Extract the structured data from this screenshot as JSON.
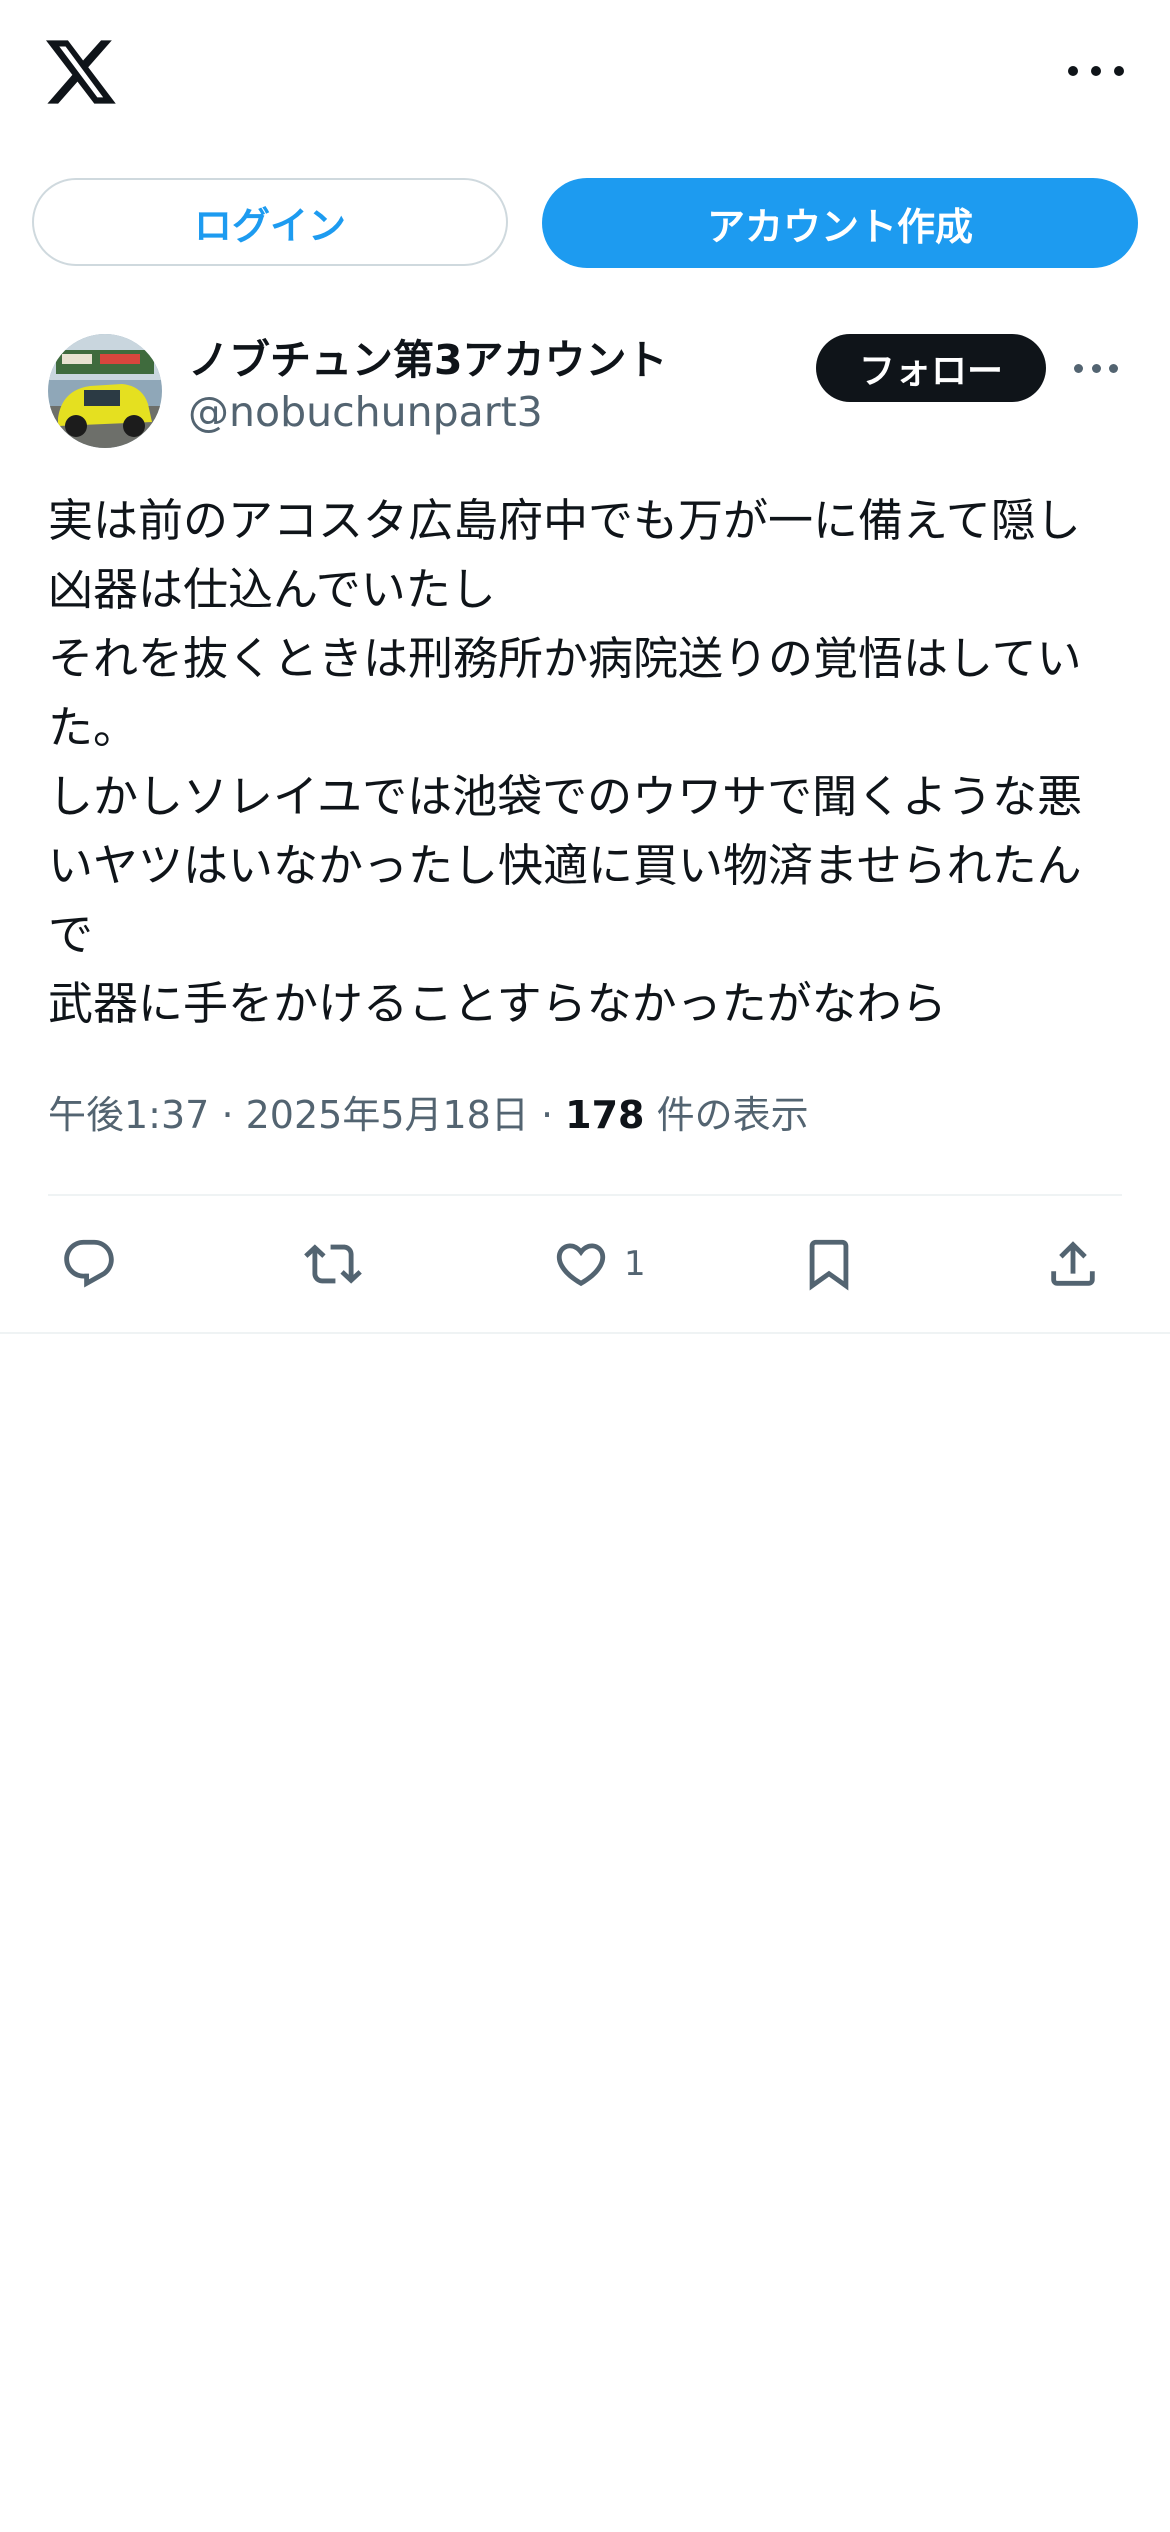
{
  "header": {
    "logo_icon": "x-logo-icon",
    "more_icon": "more-horizontal-icon"
  },
  "auth": {
    "login_label": "ログイン",
    "signup_label": "アカウント作成"
  },
  "tweet": {
    "display_name": "ノブチュン第3アカウント",
    "handle": "@nobuchunpart3",
    "follow_label": "フォロー",
    "body": "実は前のアコスタ広島府中でも万が一に備えて隠し凶器は仕込んでいたし\nそれを抜くときは刑務所か病院送りの覚悟はしていた。\nしかしソレイユでは池袋でのウワサで聞くような悪いヤツはいなかったし快適に買い物済ませられたんで\n武器に手をかけることすらなかったがなわら",
    "time": "午後1:37",
    "sep1": "·",
    "date": "2025年5月18日",
    "sep2": "·",
    "views_count": "178",
    "views_label": "件の表示",
    "like_count": "1"
  },
  "colors": {
    "accent": "#1d9bf0",
    "text": "#0f1419",
    "secondary": "#536471",
    "border": "#cfd9de"
  }
}
